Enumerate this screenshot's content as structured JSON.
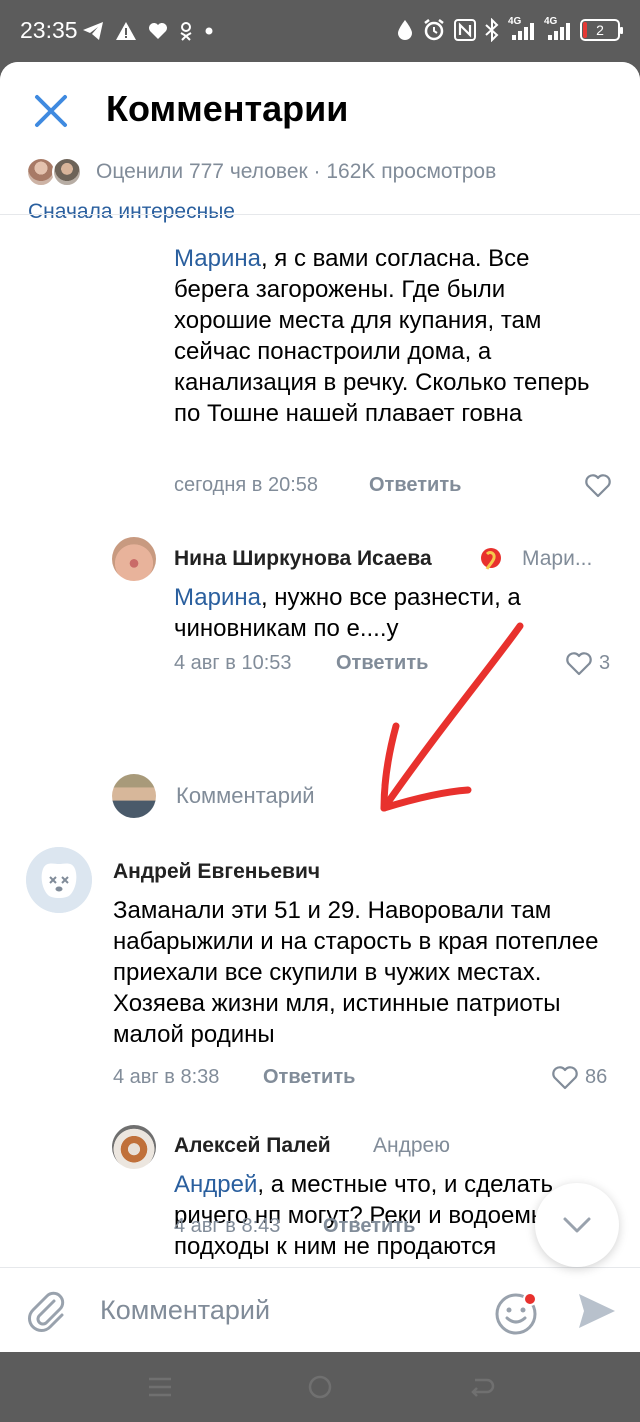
{
  "status_bar": {
    "time": "23:35",
    "network": "4G",
    "network2": "4G",
    "battery": "2",
    "icons": [
      "telegram-icon",
      "warning-icon",
      "heart-icon",
      "ok-icon",
      "dot-icon",
      "water-drop-icon",
      "alarm-icon",
      "nfc-icon",
      "bluetooth-icon",
      "signal-icon",
      "battery-icon"
    ]
  },
  "header": {
    "title": "Комментарии",
    "stats": "Оценили 777 человек · 162K просмотров",
    "sort_label": "Сначала интересные"
  },
  "comments": [
    {
      "mention": "Марина",
      "text": ", я с вами согласна. Все берега загорожены.  Где были хорошие места для купания, там сейчас понастроили дома, а канализация в речку. Сколько теперь по Тошне нашей плавает говна",
      "time": "сегодня в 20:58",
      "reply_label": "Ответить",
      "likes": ""
    },
    {
      "author": "Нина Ширкунова Исаева",
      "reply_to": "Мари...",
      "mention": "Марина",
      "text": ", нужно все разнести, а чиновникам по е....у",
      "time": "4 авг в 10:53",
      "reply_label": "Ответить",
      "likes": "3"
    },
    {
      "author": "Андрей Евгеньевич",
      "text": "Заманали эти 51 и 29. Наворовали там набарыжили и на старость в края потеплее приехали все скупили в чужих местах. Хозяева жизни мля, истинные патриоты малой родины",
      "time": "4 авг в 8:38",
      "reply_label": "Ответить",
      "likes": "86"
    },
    {
      "author": "Алексей Палей",
      "reply_to": "Андрею",
      "mention": "Андрей",
      "text": ", а местные что, и сделать ричего нп могут? Реки и водоемы и подходы к ним не продаются",
      "time": "4 авг в 8:43",
      "reply_label": "Ответить",
      "likes": ""
    }
  ],
  "thread_reply_prompt": "Комментарий",
  "input": {
    "placeholder": "Комментарий"
  },
  "colors": {
    "accent": "#2a5f9e",
    "secondary_text": "#818c99",
    "close_icon": "#3f8ae0",
    "annotation_arrow": "#e8312d",
    "badge": "#e8312d"
  }
}
